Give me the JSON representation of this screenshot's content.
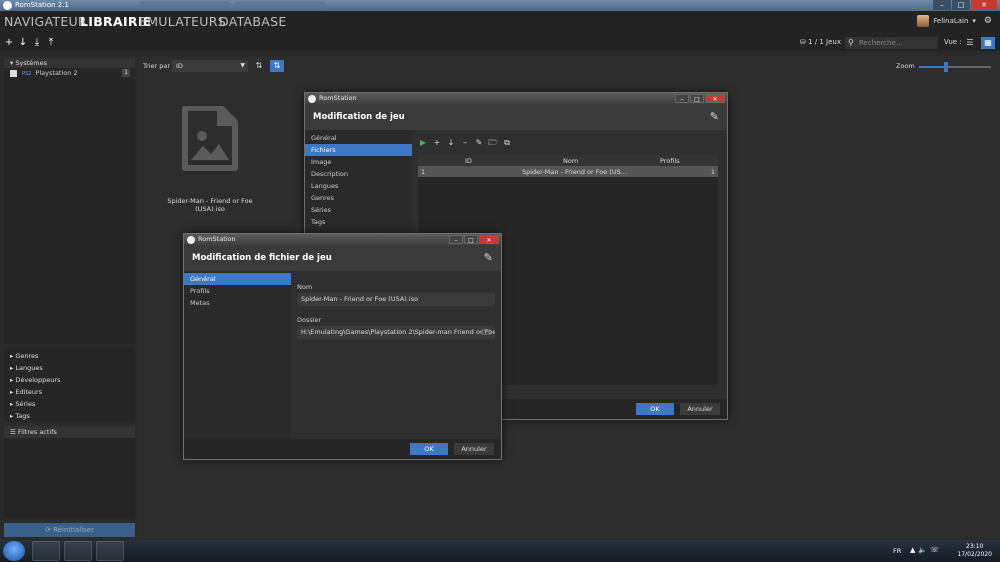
{
  "window": {
    "title": "RomStation 2.1",
    "min": "–",
    "max": "□",
    "close": "✕"
  },
  "nav": {
    "tabs": [
      "NAVIGATEUR",
      "LIBRAIRIE",
      "EMULATEURS",
      "DATABASE"
    ],
    "active": "LIBRAIRIE"
  },
  "user": {
    "name": "FelinaLain",
    "caret": "▾",
    "gear": "⚙"
  },
  "toolbar": {
    "add": "+",
    "download": "↓",
    "import": "⤓",
    "export": "⤒",
    "games_count": "1 / 1 Jeux",
    "search_placeholder": "Recherche...",
    "view_label": "Vue :"
  },
  "sidebar": {
    "systems_header": "Systèmes",
    "systems": [
      {
        "label": "Playstation 2",
        "count": "1"
      }
    ],
    "filters": [
      "Genres",
      "Langues",
      "Développeurs",
      "Editeurs",
      "Séries",
      "Tags"
    ],
    "active_filters_header": "Filtres actifs",
    "reset_label": "Réinitialiser"
  },
  "sort": {
    "label": "Trier par",
    "value": "ID",
    "zoom_label": "Zoom",
    "zoom_level": 0.38
  },
  "library": {
    "games": [
      {
        "title": "Spider-Man - Friend or Foe (USA).iso"
      }
    ]
  },
  "dialog_game": {
    "window_title": "RomStation",
    "header": "Modification de jeu",
    "nav": [
      "Général",
      "Fichiers",
      "Image",
      "Description",
      "Langues",
      "Genres",
      "Séries",
      "Tags"
    ],
    "active_nav": "Fichiers",
    "columns": [
      "ID",
      "Nom",
      "Profils"
    ],
    "rows": [
      {
        "id": "1",
        "name": "Spider-Man - Friend or Foe (US...",
        "profiles": "1"
      }
    ],
    "ok": "OK",
    "cancel": "Annuler"
  },
  "dialog_file": {
    "window_title": "RomStation",
    "header": "Modification de fichier de jeu",
    "nav": [
      "Général",
      "Profils",
      "Metas"
    ],
    "active_nav": "Général",
    "name_label": "Nom",
    "name_value": "Spider-Man - Friend or Foe (USA).iso",
    "folder_label": "Dossier",
    "folder_value": "H:\\Emulating\\Games\\Playstation 2\\Spider-man Friend or Foe",
    "ok": "OK",
    "cancel": "Annuler"
  },
  "taskbar": {
    "lang": "FR",
    "time": "23:10",
    "date": "17/02/2020"
  },
  "colors": {
    "accent": "#3c78c3",
    "close": "#c43b2f",
    "play": "#4cb050"
  }
}
